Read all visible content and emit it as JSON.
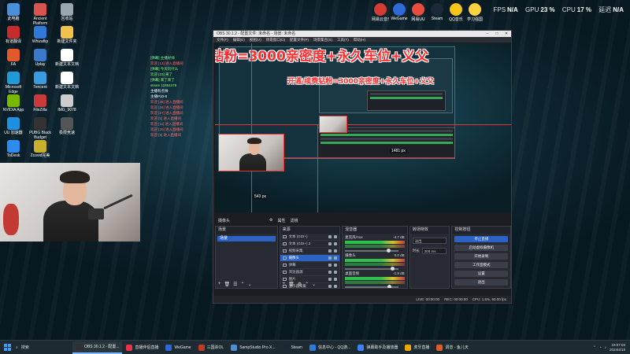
{
  "stats": {
    "fps_label": "FPS",
    "fps_value": "N/A",
    "gpu_label": "GPU",
    "gpu_value": "23 %",
    "cpu_label": "CPU",
    "cpu_value": "17 %",
    "latency_label": "延迟",
    "latency_value": "N/A"
  },
  "desktop_icons": [
    {
      "label": "此电脑",
      "color": "#4a90d9"
    },
    {
      "label": "Ancient\nPlatform",
      "color": "#d9534f"
    },
    {
      "label": "回收站",
      "color": "#9aa7b0"
    },
    {
      "label": "有道翻译",
      "color": "#c62b2b"
    },
    {
      "label": "Whizaflip",
      "color": "#2f7ad9"
    },
    {
      "label": "新建文件夹",
      "color": "#f0c14b"
    },
    {
      "label": "FA",
      "color": "#e05a2b"
    },
    {
      "label": "Uplay",
      "color": "#3a78c9"
    },
    {
      "label": "新建文本文档",
      "color": "#ffffff"
    },
    {
      "label": "Microsoft\nEdge",
      "color": "#1f9ad6"
    },
    {
      "label": "Tencent",
      "color": "#3a9be0"
    },
    {
      "label": "新建文本文档",
      "color": "#ffffff"
    },
    {
      "label": "NVIDIA App",
      "color": "#76b900"
    },
    {
      "label": "FileZilla",
      "color": "#c93b3b"
    },
    {
      "label": "IMG_9078",
      "color": "#cccccc"
    },
    {
      "label": "UU 加速器",
      "color": "#1f8fe0"
    },
    {
      "label": "PUBG Black\nBudget",
      "color": "#333333"
    },
    {
      "label": "极限竞速",
      "color": "#555555"
    },
    {
      "label": "ToDesk",
      "color": "#2d8cf0"
    },
    {
      "label": "Zcovid完美",
      "color": "#c9b02b"
    }
  ],
  "top_icons": [
    {
      "label": "网易云音乐",
      "color": "#d43c33"
    },
    {
      "label": "WeGame",
      "color": "#2c6ad8"
    },
    {
      "label": "网易UU",
      "color": "#e74c3c"
    },
    {
      "label": "Steam",
      "color": "#1b2838"
    },
    {
      "label": "QQ音乐",
      "color": "#f5c518"
    },
    {
      "label": "学习强国",
      "color": "#ffd23f"
    }
  ],
  "stream": {
    "title_overlay": "开通/续费钻粉=3000亲密度+永久车位+义父",
    "size_width_label": "1481 px",
    "size_height_label": "543 px"
  },
  "chat": [
    {
      "text": "[弹幕] 主播好帅",
      "color": "#7cff7c"
    },
    {
      "text": "欢迎 [13] 进入直播间",
      "color": "#ff6a6a"
    },
    {
      "text": "[弹幕] 今天玩什么",
      "color": "#7cff7c"
    },
    {
      "text": "欢迎 [23] 来了",
      "color": "#7cff7c"
    },
    {
      "text": "[弹幕] 来了来了",
      "color": "#7cff7c"
    },
    {
      "text": "steam 11884479",
      "color": "#7cff7c"
    },
    {
      "text": "主播有点帅",
      "color": "#ffffff"
    },
    {
      "text": "主播P10-8",
      "color": "#ffffff"
    },
    {
      "text": "欢迎 [36] 进入直播间",
      "color": "#ff6a6a"
    },
    {
      "text": "欢迎 [16] 进入直播间",
      "color": "#ff6a6a"
    },
    {
      "text": "欢迎 [27] 进入直播间",
      "color": "#ff6a6a"
    },
    {
      "text": "欢迎 [5] 进入直播间",
      "color": "#ff6a6a"
    },
    {
      "text": "欢迎 [11] 进入直播间",
      "color": "#ff6a6a"
    },
    {
      "text": "欢迎 [20] 进入直播间",
      "color": "#ff6a6a"
    },
    {
      "text": "欢迎 [9] 进入直播间",
      "color": "#ff6a6a"
    }
  ],
  "obs": {
    "window_title": "OBS 30.1.2 - 配置文件: 未命名 - 场景: 未命名",
    "menu": [
      "文件(F)",
      "编辑(E)",
      "视图(V)",
      "停靠窗口(D)",
      "配置文件(P)",
      "场景集合(S)",
      "工具(T)",
      "帮助(H)"
    ],
    "scene_label": "摄像头",
    "filter_btn": "滤镜",
    "props_btn": "属性",
    "docks": {
      "scenes": {
        "title": "场景",
        "items": [
          "场景"
        ]
      },
      "sources": {
        "title": "来源",
        "items": [
          "文本 (GDI+)",
          "文本 (GDI+) 2",
          "视频采集",
          "摄像头",
          "弹幕",
          "浏览器源",
          "图片",
          "显示器采集"
        ]
      },
      "mixer": {
        "title": "混音器",
        "channels": [
          {
            "name": "麦克风/Aux",
            "db": "-4.7 dB"
          },
          {
            "name": "摄像头",
            "db": "0.0 dB"
          },
          {
            "name": "桌面音频",
            "db": "-1.8 dB"
          }
        ]
      },
      "transitions": {
        "title": "转场特效",
        "type": "淡出",
        "duration_label": "时长",
        "duration": "300 ms"
      },
      "controls": {
        "title": "控制按钮",
        "buttons": [
          "停止直播",
          "启动虚拟摄像机",
          "开始录制",
          "工作室模式",
          "设置",
          "退出"
        ]
      }
    },
    "status": {
      "live": "LIVE: 00:00:00",
      "rec": "REC: 00:00:00",
      "cpu": "CPU: 1.5%, 60.00 fps"
    }
  },
  "taskbar": {
    "search_placeholder": "搜索",
    "apps": [
      {
        "label": "OBS 30.1.2 - 配置...",
        "color": "#302e31",
        "active": true
      },
      {
        "label": "直播伴侣直播",
        "color": "#e8334a",
        "active": false
      },
      {
        "label": "WeGame",
        "color": "#2c6ad8",
        "active": false
      },
      {
        "label": "三国杀OL",
        "color": "#c0392b",
        "active": false
      },
      {
        "label": "SampStudio Pro X...",
        "color": "#4a90d9",
        "active": false
      },
      {
        "label": "Steam",
        "color": "#1b2838",
        "active": false
      },
      {
        "label": "信息中心 - QQ游...",
        "color": "#2f7ad9",
        "active": false
      },
      {
        "label": "弹幕助手及播放器",
        "color": "#3b82f6",
        "active": false
      },
      {
        "label": "虎牙直播",
        "color": "#f0a500",
        "active": false
      },
      {
        "label": "调音 - 鱼儿天",
        "color": "#e05a2b",
        "active": false
      }
    ],
    "time": "19:07:03",
    "date": "2024/4/19"
  }
}
